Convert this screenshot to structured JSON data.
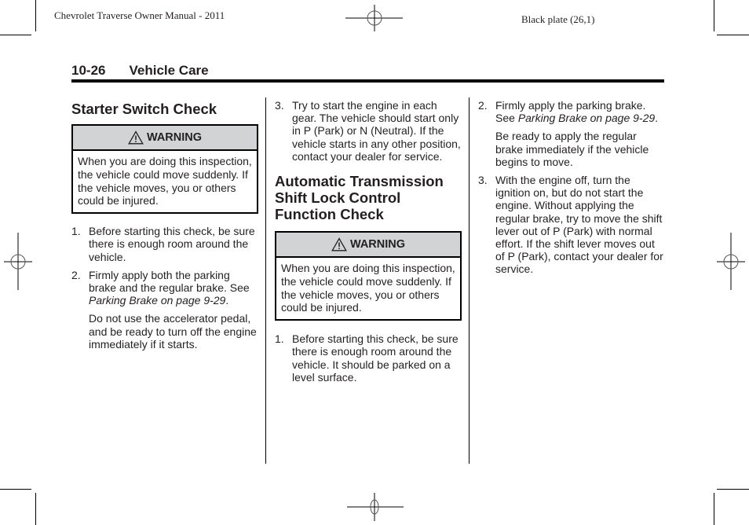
{
  "running_head": {
    "left": "Chevrolet Traverse Owner Manual - 2011",
    "right": "Black plate (26,1)"
  },
  "page_header": {
    "page_number": "10-26",
    "section": "Vehicle Care"
  },
  "icons": {
    "registration_mark": "crosshair-circle",
    "warning": "warning-triangle-icon"
  },
  "columns": {
    "col1": {
      "title": "Starter Switch Check",
      "warning": {
        "label": "WARNING",
        "text": "When you are doing this inspection, the vehicle could move suddenly. If the vehicle moves, you or others could be injured."
      },
      "steps": [
        {
          "num": "1.",
          "text": "Before starting this check, be sure there is enough room around the vehicle."
        },
        {
          "num": "2.",
          "text_before": "Firmly apply both the parking brake and the regular brake. See ",
          "ref": "Parking Brake on page 9-29",
          "text_after": ".",
          "note": "Do not use the accelerator pedal, and be ready to turn off the engine immediately if it starts."
        }
      ]
    },
    "col2": {
      "continued_steps": [
        {
          "num": "3.",
          "text": "Try to start the engine in each gear. The vehicle should start only in P (Park) or N (Neutral). If the vehicle starts in any other position, contact your dealer for service."
        }
      ],
      "title": "Automatic Transmission Shift Lock Control Function Check",
      "warning": {
        "label": "WARNING",
        "text": "When you are doing this inspection, the vehicle could move suddenly. If the vehicle moves, you or others could be injured."
      },
      "steps": [
        {
          "num": "1.",
          "text": "Before starting this check, be sure there is enough room around the vehicle. It should be parked on a level surface."
        }
      ]
    },
    "col3": {
      "steps": [
        {
          "num": "2.",
          "text_before": "Firmly apply the parking brake. See ",
          "ref": "Parking Brake on page 9-29",
          "text_after": ".",
          "note": "Be ready to apply the regular brake immediately if the vehicle begins to move."
        },
        {
          "num": "3.",
          "text": "With the engine off, turn the ignition on, but do not start the engine. Without applying the regular brake, try to move the shift lever out of P (Park) with normal effort. If the shift lever moves out of P (Park), contact your dealer for service."
        }
      ]
    }
  }
}
